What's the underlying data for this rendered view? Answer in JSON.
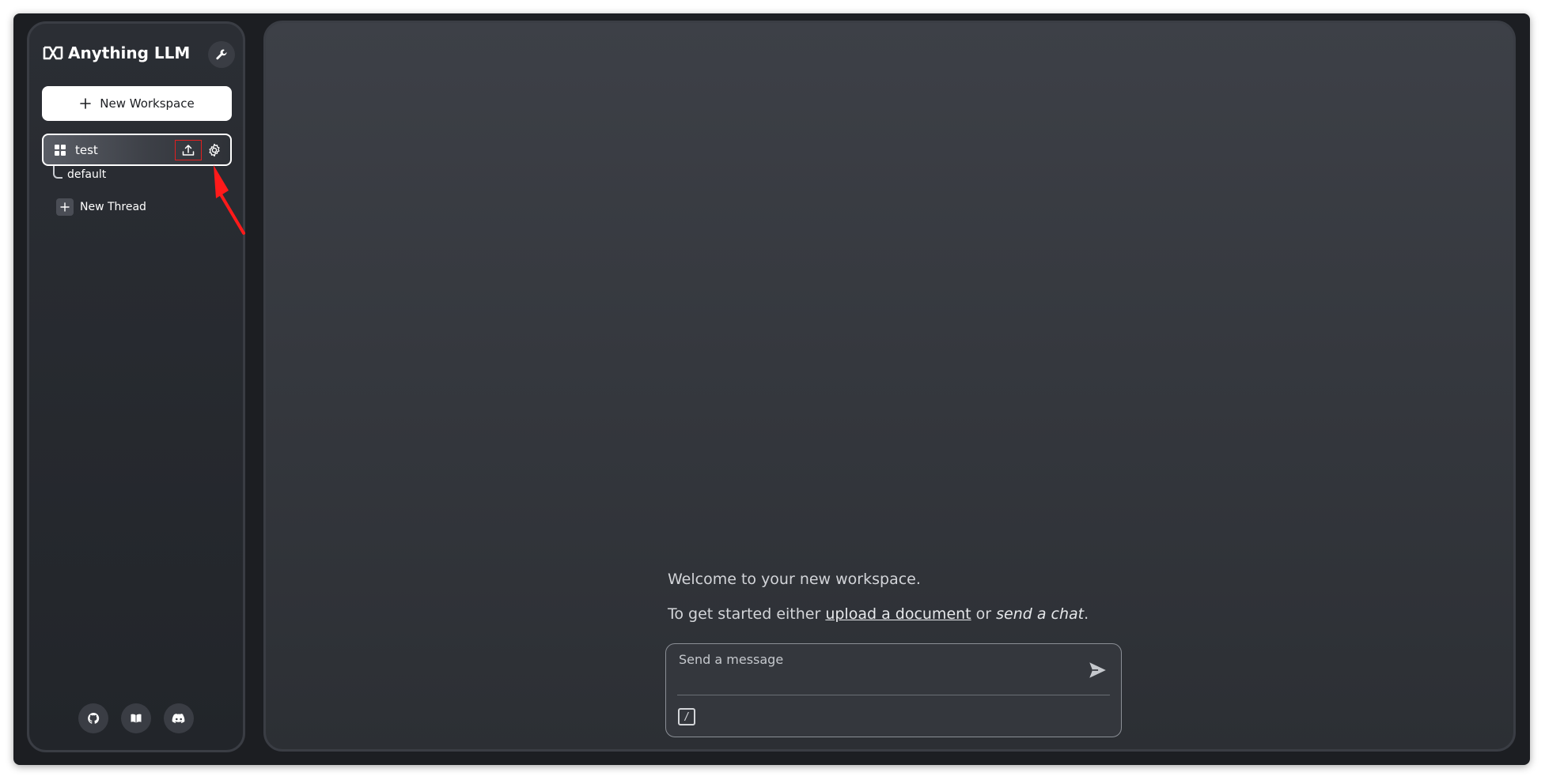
{
  "brand": {
    "name": "Anything LLM"
  },
  "sidebar": {
    "new_workspace_label": "New Workspace",
    "workspaces": [
      {
        "name": "test",
        "threads": [
          {
            "name": "default"
          }
        ]
      }
    ],
    "new_thread_label": "New Thread",
    "footer_icons": [
      "github-icon",
      "docs-book-icon",
      "discord-icon"
    ]
  },
  "main": {
    "welcome_text": "Welcome to your new workspace.",
    "getting_started_prefix": "To get started either ",
    "upload_link": "upload a document",
    "or_text": " or ",
    "send_chat": "send a chat",
    "period": "."
  },
  "composer": {
    "placeholder": "Send a message",
    "value": "",
    "slash_label": "/"
  },
  "colors": {
    "background": "#1c1e22",
    "panel": "#2c2f34",
    "accent_highlight": "#e02020",
    "text": "#ffffff"
  }
}
